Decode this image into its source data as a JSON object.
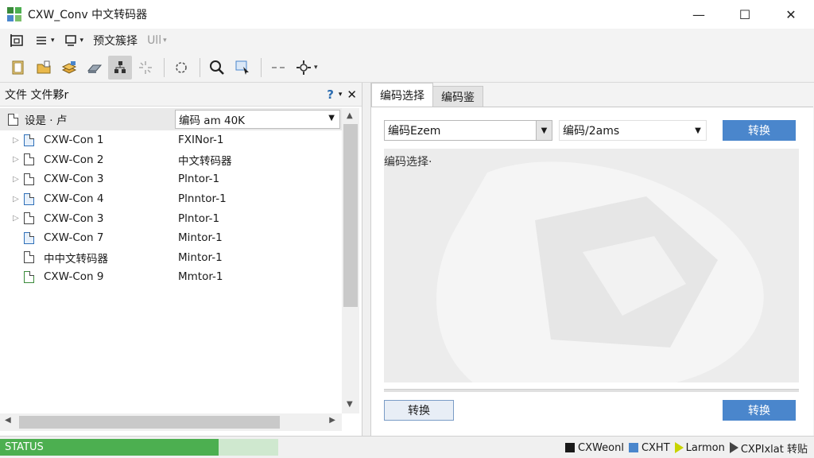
{
  "window": {
    "title": "CXW_Conv 中文转码器",
    "minimize_glyph": "—",
    "maximize_glyph": "☐",
    "close_glyph": "✕"
  },
  "colors": {
    "accent": "#4a86cc",
    "status_green": "#4caf50",
    "app_icon": [
      "#3a8a3a",
      "#4caf50",
      "#4a86cc",
      "#7bbf6a"
    ]
  },
  "menu": {
    "items": [
      {
        "icon": "open-panel-icon",
        "label": ""
      },
      {
        "icon": "list-icon",
        "label": ""
      },
      {
        "icon": "monitor-icon",
        "label": ""
      },
      {
        "label": "预文簇择"
      },
      {
        "label": "Ull"
      }
    ]
  },
  "toolbar": {
    "buttons": [
      "new-file-icon",
      "open-folder-icon",
      "layers-icon",
      "eraser-icon",
      "tree-icon",
      "spark-icon",
      "gear-outline-icon",
      "search-icon",
      "select-icon",
      "dash-icon",
      "settings-icon"
    ]
  },
  "left_pane": {
    "header": "文件 文件夥r",
    "help_glyph": "?",
    "close_glyph": "✕",
    "header_row": {
      "name": "设是 · 卢",
      "value": "编码 am 40K"
    },
    "rows": [
      {
        "name": "CXW-Con 1",
        "value": "FXINor-1",
        "icon": "document-icon",
        "expander": true,
        "variant": "blue"
      },
      {
        "name": "CXW-Con 2",
        "value": "中文转码器",
        "icon": "document-icon",
        "expander": true,
        "variant": ""
      },
      {
        "name": "CXW-Con 3",
        "value": "Plntor-1",
        "icon": "document-icon",
        "expander": true,
        "variant": ""
      },
      {
        "name": "CXW-Con 4",
        "value": "Plnntor-1",
        "icon": "document-icon",
        "expander": true,
        "variant": "blue"
      },
      {
        "name": "CXW-Con 3",
        "value": "Plntor-1",
        "icon": "document-icon",
        "expander": true,
        "variant": ""
      },
      {
        "name": "CXW-Con 7",
        "value": "Mintor-1",
        "icon": "document-icon",
        "expander": false,
        "variant": "blue"
      },
      {
        "name": "中中文转码器",
        "value": "Mintor-1",
        "icon": "document-icon",
        "expander": false,
        "variant": ""
      },
      {
        "name": "CXW-Con 9",
        "value": "Mmtor-1",
        "icon": "document-icon",
        "expander": false,
        "variant": "green"
      }
    ]
  },
  "right_pane": {
    "tabs": [
      {
        "label": "编码选择",
        "active": true
      },
      {
        "label": "编码鉴",
        "active": false
      }
    ],
    "source_select": "编码Ezem",
    "target_select": "编码/2ams",
    "convert_top": "转换",
    "preview_label": "编码选择·",
    "convert_left": "转换",
    "convert_right": "转换"
  },
  "status": {
    "text": "STATUS",
    "progress_fraction": 0.785,
    "items": [
      {
        "label": "CXWeonl",
        "marker": "square",
        "color": "#1a1a1a"
      },
      {
        "label": "CXHT",
        "marker": "square",
        "color": "#4a86cc"
      },
      {
        "label": "Larmon",
        "marker": "triangle",
        "color": "#c8d400"
      },
      {
        "label": "CXPIxlat 转贴",
        "marker": "triangle",
        "color": "#444444"
      }
    ]
  }
}
